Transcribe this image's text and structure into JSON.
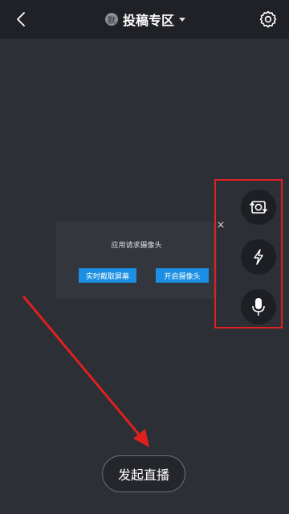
{
  "header": {
    "default_badge": "默",
    "title": "投稿专区"
  },
  "camera_request": {
    "message": "应用请求摄像头",
    "screen_capture_label": "实时截取屏幕",
    "open_camera_label": "开启摄像头",
    "close_symbol": "×"
  },
  "side_controls": [
    "camera-flip-icon",
    "flash-icon",
    "microphone-icon"
  ],
  "footer": {
    "start_live_label": "发起直播"
  },
  "colors": {
    "background": "#2c2f35",
    "topbar": "#1f2126",
    "accent_blue": "#1a8fe3",
    "annotation_red": "#e02020"
  }
}
